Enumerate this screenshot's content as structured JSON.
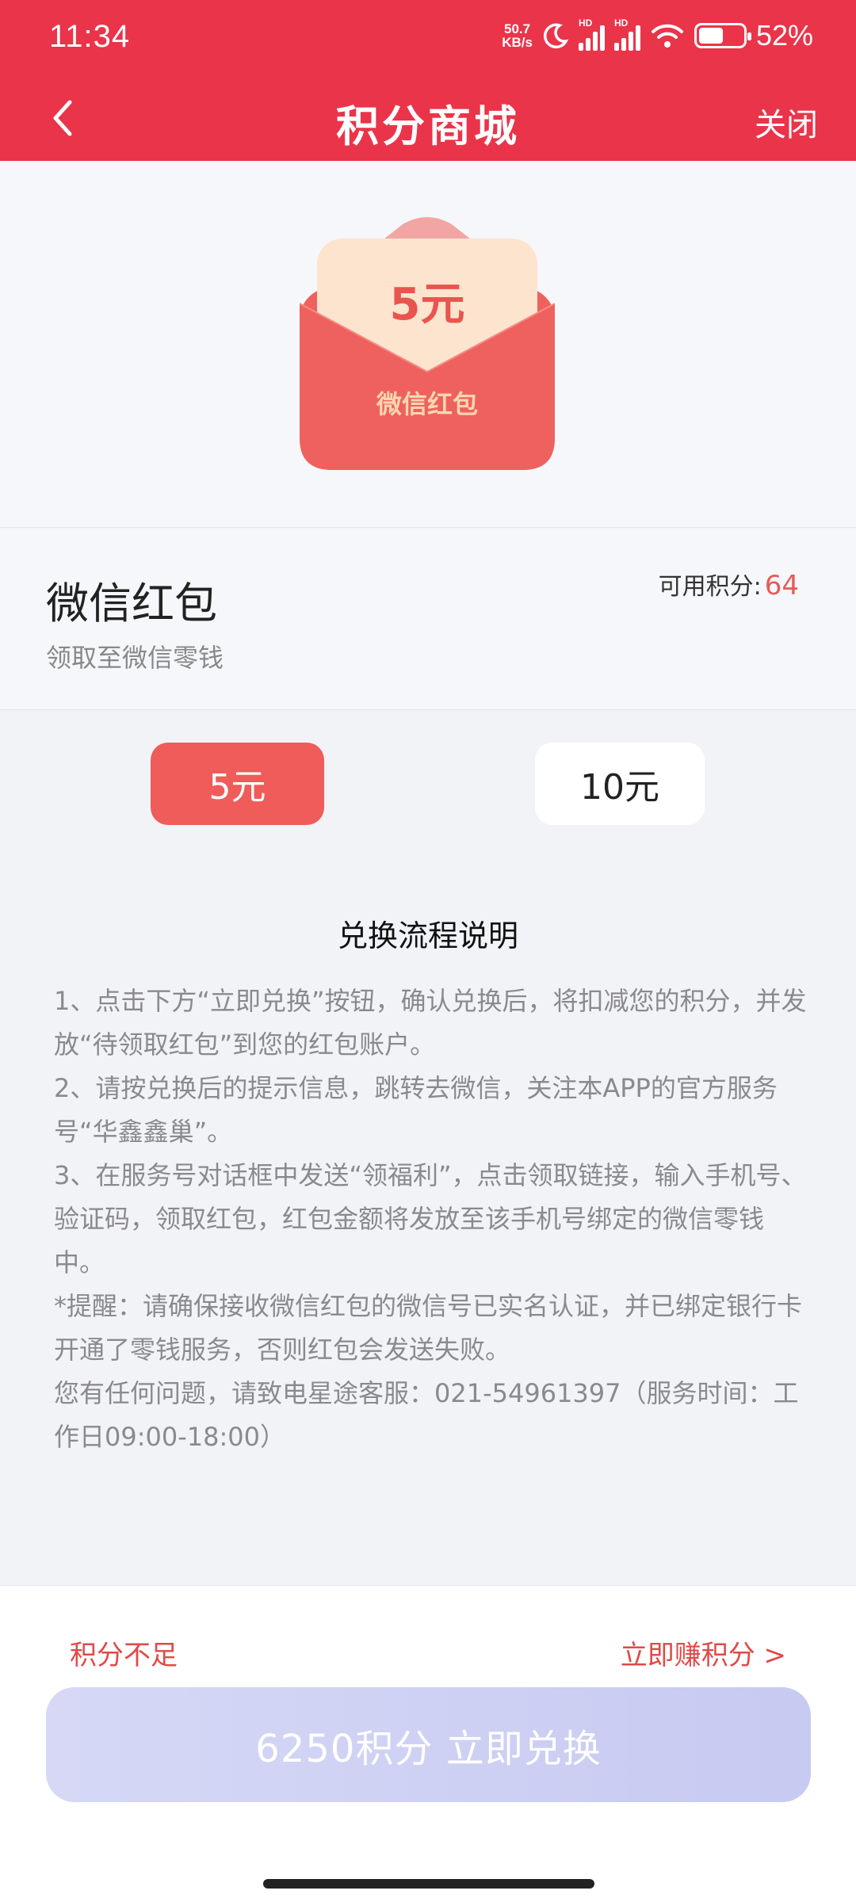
{
  "status_bar": {
    "time": "11:34",
    "speed_value": "50.7",
    "speed_unit": "KB/s",
    "network_1": "HD",
    "network_2": "HD",
    "battery_percent": "52%"
  },
  "nav": {
    "title": "积分商城",
    "close_label": "关闭"
  },
  "hero": {
    "amount": "5元",
    "label": "微信红包"
  },
  "info": {
    "title": "微信红包",
    "subtitle": "领取至微信零钱",
    "points_label": "可用积分:",
    "points_value": "64"
  },
  "options": [
    {
      "label": "5元",
      "selected": true
    },
    {
      "label": "10元",
      "selected": false
    }
  ],
  "instructions": {
    "title": "兑换流程说明",
    "lines": [
      "1、点击下方“立即兑换”按钮，确认兑换后，将扣减您的积分，并发放“待领取红包”到您的红包账户。",
      "2、请按兑换后的提示信息，跳转去微信，关注本APP的官方服务号“华鑫鑫巢”。",
      "3、在服务号对话框中发送“领福利”，点击领取链接，输入手机号、验证码，领取红包，红包金额将发放至该手机号绑定的微信零钱中。",
      "*提醒：请确保接收微信红包的微信号已实名认证，并已绑定银行卡开通了零钱服务，否则红包会发送失败。",
      "您有任何问题，请致电星途客服：021-54961397（服务时间：工作日09:00-18:00）"
    ]
  },
  "footer": {
    "insufficient_label": "积分不足",
    "earn_label": "立即赚积分 >",
    "redeem_label": "6250积分 立即兑换"
  },
  "colors": {
    "header_red": "#ea3449",
    "accent_red": "#e85a55",
    "redeem_button": "#cacdf3"
  }
}
